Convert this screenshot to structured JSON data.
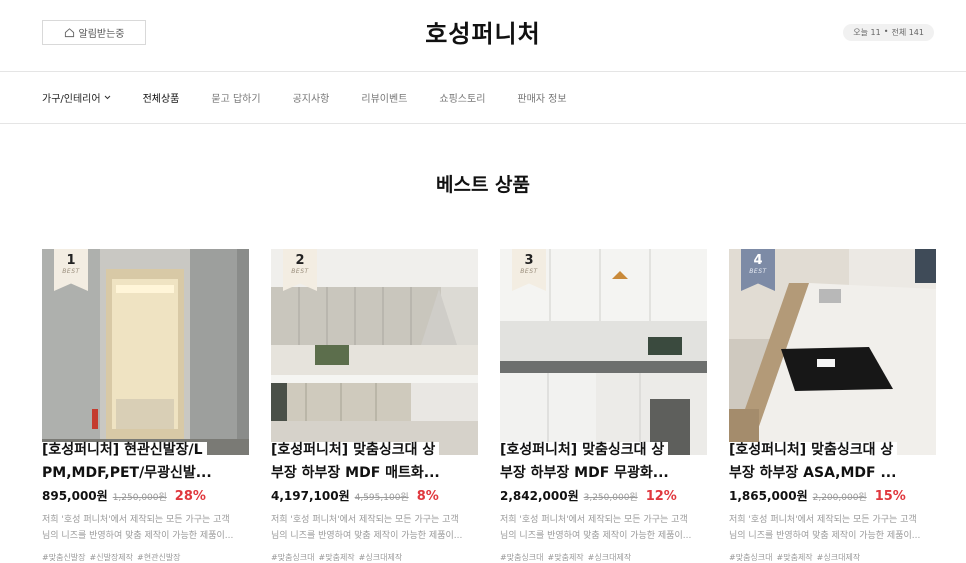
{
  "header": {
    "alarm_label": "알림받는중",
    "logo": "호성퍼니처",
    "visit_today": "오늘 11",
    "visit_sep": "•",
    "visit_total": "전체 141"
  },
  "nav": {
    "items": [
      {
        "label": "가구/인테리어"
      },
      {
        "label": "전체상품"
      },
      {
        "label": "묻고 답하기"
      },
      {
        "label": "공지사항"
      },
      {
        "label": "리뷰이벤트"
      },
      {
        "label": "쇼핑스토리"
      },
      {
        "label": "판매자 정보"
      }
    ]
  },
  "section_title": "베스트 상품",
  "products": [
    {
      "rank": "1",
      "best": "BEST",
      "title_line1": "[호성퍼니처] 현관신발장/L",
      "title_line2": "PM,MDF,PET/무광신발...",
      "price": "895,000원",
      "orig_price": "1,250,000원",
      "discount": "28%",
      "desc_line1": "저희 '호성 퍼니처'에서 제작되는 모든 가구는 고객",
      "desc_line2": "님의 니즈를 반영하여 맞춤 제작이 가능한 제품이...",
      "tags": [
        "#맞춤신발장",
        "#신발장제작",
        "#현관신발장"
      ]
    },
    {
      "rank": "2",
      "best": "BEST",
      "title_line1": "[호성퍼니처] 맞춤싱크대 상",
      "title_line2": "부장 하부장 MDF 매트화...",
      "price": "4,197,100원",
      "orig_price": "4,595,100원",
      "discount": "8%",
      "desc_line1": "저희 '호성 퍼니처'에서 제작되는 모든 가구는 고객",
      "desc_line2": "님의 니즈를 반영하여 맞춤 제작이 가능한 제품이...",
      "tags": [
        "#맞춤싱크대",
        "#맞춤제작",
        "#싱크대제작"
      ]
    },
    {
      "rank": "3",
      "best": "BEST",
      "title_line1": "[호성퍼니처] 맞춤싱크대 상",
      "title_line2": "부장 하부장 MDF 무광화...",
      "price": "2,842,000원",
      "orig_price": "3,250,000원",
      "discount": "12%",
      "desc_line1": "저희 '호성 퍼니처'에서 제작되는 모든 가구는 고객",
      "desc_line2": "님의 니즈를 반영하여 맞춤 제작이 가능한 제품이...",
      "tags": [
        "#맞춤싱크대",
        "#맞춤제작",
        "#싱크대제작"
      ]
    },
    {
      "rank": "4",
      "best": "BEST",
      "title_line1": "[호성퍼니처] 맞춤싱크대 상",
      "title_line2": "부장 하부장 ASA,MDF ...",
      "price": "1,865,000원",
      "orig_price": "2,200,000원",
      "discount": "15%",
      "desc_line1": "저희 '호성 퍼니처'에서 제작되는 모든 가구는 고객",
      "desc_line2": "님의 니즈를 반영하여 맞춤 제작이 가능한 제품이...",
      "tags": [
        "#맞춤싱크대",
        "#맞춤제작",
        "#싱크대제작"
      ]
    }
  ]
}
